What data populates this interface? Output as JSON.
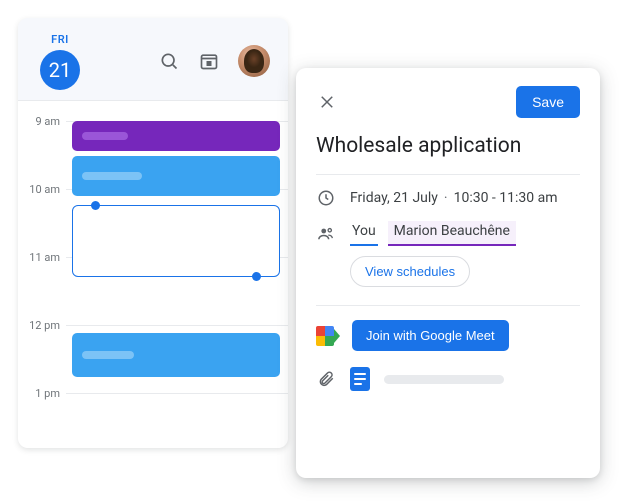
{
  "calendar": {
    "day_name": "FRI",
    "day_number": "21",
    "times": [
      "9 am",
      "10 am",
      "11 am",
      "12 pm",
      "1 pm"
    ]
  },
  "detail": {
    "save_label": "Save",
    "title": "Wholesale application",
    "date": "Friday, 21 July",
    "time": "10:30 - 11:30 am",
    "guests": {
      "you": "You",
      "other": "Marion Beauchêne"
    },
    "view_schedules_label": "View schedules",
    "meet_label": "Join with Google Meet"
  }
}
